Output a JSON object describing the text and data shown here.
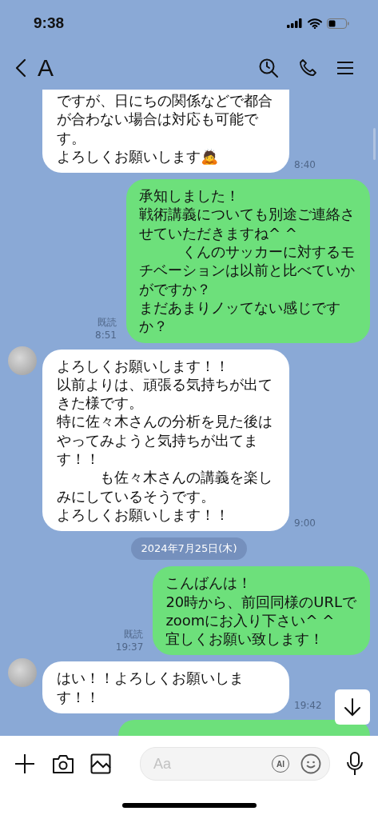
{
  "status_bar": {
    "time": "9:38"
  },
  "header": {
    "title": "A"
  },
  "messages": [
    {
      "kind": "incoming",
      "clipped": true,
      "avatar": false,
      "lines": [
        "ですが、日にちの関係などで都合が合わない場合は対応も可能です。",
        "よろしくお願いします🙇"
      ],
      "time": "8:40"
    },
    {
      "kind": "outgoing",
      "read": "既読",
      "lines": [
        "承知しました！",
        "戦術講義についても別途ご連絡させていただきますね^ ^",
        "　　　くんのサッカーに対するモチベーションは以前と比べていかがですか？",
        "まだあまりノッてない感じですか？"
      ],
      "time": "8:51"
    },
    {
      "kind": "incoming",
      "clipped": false,
      "avatar": true,
      "lines": [
        "よろしくお願いします！！",
        "以前よりは、頑張る気持ちが出てきた様です。",
        "特に佐々木さんの分析を見た後はやってみようと気持ちが出てます！！",
        "　　　も佐々木さんの講義を楽しみにしているそうです。",
        "よろしくお願いします！！"
      ],
      "time": "9:00"
    },
    {
      "kind": "date",
      "text": "2024年7月25日(木)"
    },
    {
      "kind": "outgoing",
      "read": "既読",
      "lines": [
        "こんばんは！",
        "20時から、前回同様のURLで",
        "zoomにお入り下さい^ ^",
        "宜しくお願い致します！"
      ],
      "time": "19:37"
    },
    {
      "kind": "incoming",
      "clipped": false,
      "avatar": true,
      "lines": [
        "はい！！よろしくお願いします！！"
      ],
      "time": "19:42"
    },
    {
      "kind": "cut"
    }
  ],
  "composer": {
    "placeholder": "Aa",
    "ai_label": "AI"
  }
}
